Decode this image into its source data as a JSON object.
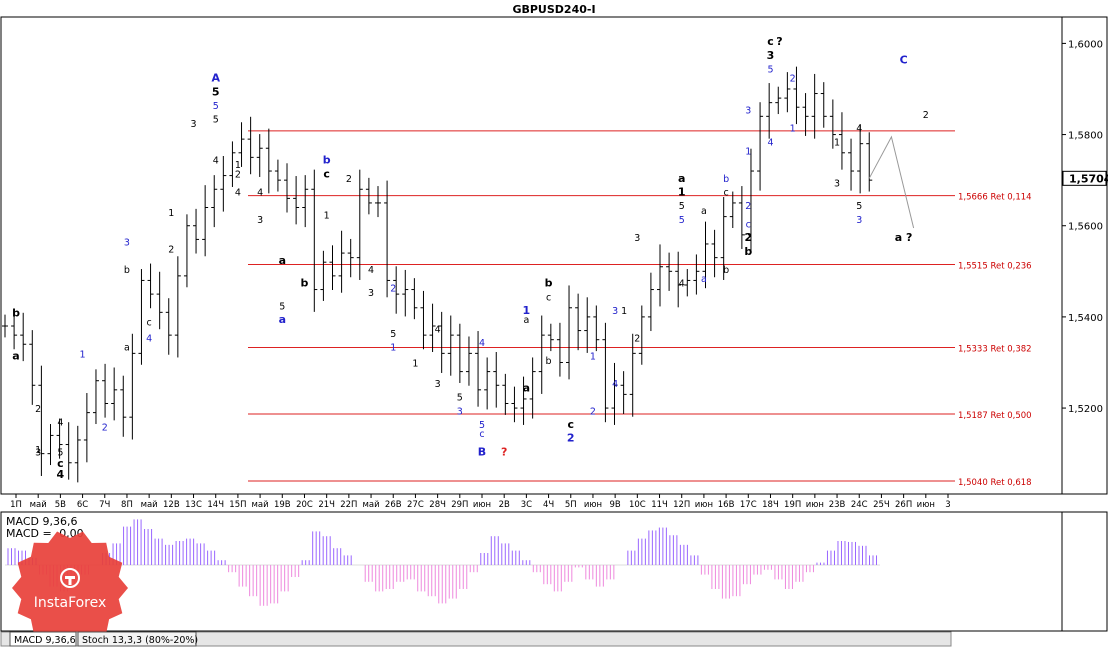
{
  "chart_data": {
    "type": "ohlc",
    "title": "GBPUSD240-I",
    "xlabel": "",
    "ylabel": "",
    "ylim": [
      1.504,
      1.6025
    ],
    "y_ticks": [
      "1,6000",
      "1,5800",
      "1,5600",
      "1,5400",
      "1,5200"
    ],
    "y_tick_values": [
      1.6,
      1.58,
      1.56,
      1.54,
      1.52
    ],
    "current_price": "1,5704",
    "current_price_value": 1.5704,
    "x_tick_labels": [
      "1П",
      "май",
      "5В",
      "6С",
      "7Ч",
      "8П",
      "май",
      "12В",
      "13С",
      "14Ч",
      "15П",
      "май",
      "19В",
      "20С",
      "21Ч",
      "22П",
      "май",
      "26В",
      "27С",
      "28Ч",
      "29П",
      "июн",
      "2В",
      "3С",
      "4Ч",
      "5П",
      "июн",
      "9В",
      "10С",
      "11Ч",
      "12П",
      "июн",
      "16В",
      "17С",
      "18Ч",
      "19П",
      "июн",
      "23В",
      "24С",
      "25Ч",
      "26П",
      "июн",
      "3"
    ],
    "close_series": [
      1.538,
      1.536,
      1.534,
      1.525,
      1.51,
      1.514,
      1.512,
      1.508,
      1.513,
      1.519,
      1.526,
      1.521,
      1.524,
      1.518,
      1.532,
      1.548,
      1.545,
      1.541,
      1.536,
      1.549,
      1.56,
      1.557,
      1.564,
      1.568,
      1.571,
      1.576,
      1.579,
      1.575,
      1.577,
      1.572,
      1.57,
      1.566,
      1.564,
      1.568,
      1.546,
      1.552,
      1.549,
      1.554,
      1.553,
      1.568,
      1.565,
      1.565,
      1.548,
      1.545,
      1.546,
      1.542,
      1.536,
      1.538,
      1.532,
      1.536,
      1.528,
      1.532,
      1.524,
      1.528,
      1.525,
      1.521,
      1.52,
      1.522,
      1.528,
      1.536,
      1.535,
      1.53,
      1.542,
      1.537,
      1.54,
      1.535,
      1.52,
      1.525,
      1.523,
      1.532,
      1.54,
      1.546,
      1.551,
      1.55,
      1.547,
      1.548,
      1.55,
      1.556,
      1.553,
      1.562,
      1.565,
      1.558,
      1.572,
      1.584,
      1.587,
      1.588,
      1.59,
      1.586,
      1.584,
      1.589,
      1.584,
      1.58,
      1.576,
      1.572,
      1.578,
      1.57
    ],
    "price_lines": [
      {
        "label": "1,5666 Ret 0,114",
        "value": 1.5666
      },
      {
        "label": "1,5515 Ret 0,236",
        "value": 1.5515
      },
      {
        "label": "1,5333 Ret 0,382",
        "value": 1.5333
      },
      {
        "label": "1,5187 Ret 0,500",
        "value": 1.5187
      },
      {
        "label": "1,5040 Ret 0,618",
        "value": 1.504
      }
    ],
    "top_line_value": 1.5808,
    "projection": [
      {
        "x": "24С",
        "y": 1.5704
      },
      {
        "x": "25Ч",
        "y": 1.5795
      },
      {
        "x": "26П",
        "y": 1.5595
      }
    ],
    "wave_labels": [
      {
        "text": "b",
        "x": "1П",
        "y": 1.541,
        "color": "#000000",
        "bold": true
      },
      {
        "text": "a",
        "x": "1П",
        "y": 1.5315,
        "color": "#000000",
        "bold": true
      },
      {
        "text": "1",
        "x": "май",
        "y": 1.511,
        "color": "#000000",
        "bold": false
      },
      {
        "text": "2",
        "x": "май",
        "y": 1.52,
        "color": "#000000",
        "bold": false
      },
      {
        "text": "3",
        "x": "май",
        "y": 1.5105,
        "color": "#000000",
        "bold": false
      },
      {
        "text": "4",
        "x": "5В",
        "y": 1.517,
        "color": "#000000",
        "bold": false
      },
      {
        "text": "5",
        "x": "5В",
        "y": 1.5105,
        "color": "#000000",
        "bold": false
      },
      {
        "text": "c",
        "x": "5В",
        "y": 1.508,
        "color": "#000000",
        "bold": true
      },
      {
        "text": "4",
        "x": "5В",
        "y": 1.5055,
        "color": "#000000",
        "bold": true
      },
      {
        "text": "1",
        "x": "6С",
        "y": 1.532,
        "color": "#2222cc",
        "bold": false
      },
      {
        "text": "2",
        "x": "7Ч",
        "y": 1.516,
        "color": "#2222cc",
        "bold": false
      },
      {
        "text": "3",
        "x": "8П",
        "y": 1.5565,
        "color": "#2222cc",
        "bold": false
      },
      {
        "text": "a",
        "x": "8П",
        "y": 1.5335,
        "color": "#000000",
        "bold": false
      },
      {
        "text": "b",
        "x": "8П",
        "y": 1.5505,
        "color": "#000000",
        "bold": false
      },
      {
        "text": "c",
        "x": "май",
        "y": 1.539,
        "color": "#000000",
        "bold": false
      },
      {
        "text": "4",
        "x": "май",
        "y": 1.5355,
        "color": "#2222cc",
        "bold": false
      },
      {
        "text": "1",
        "x": "12В",
        "y": 1.563,
        "color": "#000000",
        "bold": false
      },
      {
        "text": "2",
        "x": "12В",
        "y": 1.555,
        "color": "#000000",
        "bold": false
      },
      {
        "text": "3",
        "x": "13С",
        "y": 1.5825,
        "color": "#000000",
        "bold": false
      },
      {
        "text": "4",
        "x": "14Ч",
        "y": 1.5745,
        "color": "#000000",
        "bold": false
      },
      {
        "text": "A",
        "x": "14Ч",
        "y": 1.5925,
        "color": "#2222cc",
        "bold": true
      },
      {
        "text": "5",
        "x": "14Ч",
        "y": 1.5895,
        "color": "#000000",
        "bold": true
      },
      {
        "text": "5",
        "x": "14Ч",
        "y": 1.5865,
        "color": "#2222cc",
        "bold": false
      },
      {
        "text": "5",
        "x": "14Ч",
        "y": 1.5835,
        "color": "#000000",
        "bold": false
      },
      {
        "text": "4",
        "x": "15П",
        "y": 1.5675,
        "color": "#000000",
        "bold": false
      },
      {
        "text": "1",
        "x": "15П",
        "y": 1.5735,
        "color": "#000000",
        "bold": false
      },
      {
        "text": "2",
        "x": "15П",
        "y": 1.5715,
        "color": "#000000",
        "bold": false
      },
      {
        "text": "3",
        "x": "май",
        "y": 1.5615,
        "color": "#000000",
        "bold": false
      },
      {
        "text": "4",
        "x": "май",
        "y": 1.5675,
        "color": "#000000",
        "bold": false
      },
      {
        "text": "a",
        "x": "19В",
        "y": 1.5525,
        "color": "#000000",
        "bold": true
      },
      {
        "text": "5",
        "x": "19В",
        "y": 1.5425,
        "color": "#000000",
        "bold": false
      },
      {
        "text": "a",
        "x": "19В",
        "y": 1.5395,
        "color": "#2222cc",
        "bold": true
      },
      {
        "text": "b",
        "x": "20С",
        "y": 1.5475,
        "color": "#000000",
        "bold": true
      },
      {
        "text": "b",
        "x": "21Ч",
        "y": 1.5745,
        "color": "#2222cc",
        "bold": true
      },
      {
        "text": "c",
        "x": "21Ч",
        "y": 1.5715,
        "color": "#000000",
        "bold": true
      },
      {
        "text": "1",
        "x": "21Ч",
        "y": 1.5625,
        "color": "#000000",
        "bold": false
      },
      {
        "text": "2",
        "x": "22П",
        "y": 1.5705,
        "color": "#000000",
        "bold": false
      },
      {
        "text": "3",
        "x": "май",
        "y": 1.5455,
        "color": "#000000",
        "bold": false
      },
      {
        "text": "4",
        "x": "май",
        "y": 1.5505,
        "color": "#000000",
        "bold": false
      },
      {
        "text": "2",
        "x": "26В",
        "y": 1.5465,
        "color": "#2222cc",
        "bold": false
      },
      {
        "text": "5",
        "x": "26В",
        "y": 1.5365,
        "color": "#000000",
        "bold": false
      },
      {
        "text": "1",
        "x": "26В",
        "y": 1.5335,
        "color": "#2222cc",
        "bold": false
      },
      {
        "text": "1",
        "x": "27С",
        "y": 1.53,
        "color": "#000000",
        "bold": false
      },
      {
        "text": "4",
        "x": "28Ч",
        "y": 1.5375,
        "color": "#000000",
        "bold": false
      },
      {
        "text": "3",
        "x": "28Ч",
        "y": 1.5255,
        "color": "#000000",
        "bold": false
      },
      {
        "text": "5",
        "x": "29П",
        "y": 1.5225,
        "color": "#000000",
        "bold": false
      },
      {
        "text": "3",
        "x": "29П",
        "y": 1.5195,
        "color": "#2222cc",
        "bold": false
      },
      {
        "text": "4",
        "x": "июн",
        "y": 1.5345,
        "color": "#2222cc",
        "bold": false
      },
      {
        "text": "5",
        "x": "июн",
        "y": 1.5165,
        "color": "#2222cc",
        "bold": false
      },
      {
        "text": "c",
        "x": "июн",
        "y": 1.5145,
        "color": "#2222cc",
        "bold": false
      },
      {
        "text": "B",
        "x": "июн",
        "y": 1.5105,
        "color": "#2222cc",
        "bold": true
      },
      {
        "text": "?",
        "x": "2В",
        "y": 1.5105,
        "color": "#dd2222",
        "bold": true
      },
      {
        "text": "1",
        "x": "3С",
        "y": 1.5415,
        "color": "#2222cc",
        "bold": true
      },
      {
        "text": "a",
        "x": "3С",
        "y": 1.5395,
        "color": "#000000",
        "bold": false
      },
      {
        "text": "a",
        "x": "3С",
        "y": 1.5245,
        "color": "#000000",
        "bold": true
      },
      {
        "text": "b",
        "x": "4Ч",
        "y": 1.5475,
        "color": "#000000",
        "bold": true
      },
      {
        "text": "c",
        "x": "4Ч",
        "y": 1.5445,
        "color": "#000000",
        "bold": false
      },
      {
        "text": "b",
        "x": "4Ч",
        "y": 1.5305,
        "color": "#000000",
        "bold": false
      },
      {
        "text": "c",
        "x": "5П",
        "y": 1.5165,
        "color": "#000000",
        "bold": true
      },
      {
        "text": "2",
        "x": "5П",
        "y": 1.5135,
        "color": "#2222cc",
        "bold": true
      },
      {
        "text": "1",
        "x": "июн",
        "y": 1.5315,
        "color": "#2222cc",
        "bold": false
      },
      {
        "text": "2",
        "x": "июн",
        "y": 1.5195,
        "color": "#2222cc",
        "bold": false
      },
      {
        "text": "3",
        "x": "9В",
        "y": 1.5415,
        "color": "#2222cc",
        "bold": false
      },
      {
        "text": "4",
        "x": "9В",
        "y": 1.5255,
        "color": "#2222cc",
        "bold": false
      },
      {
        "text": "1",
        "x": "9В",
        "y": 1.5415,
        "color": "#000000",
        "bold": false
      },
      {
        "text": "2",
        "x": "10С",
        "y": 1.5355,
        "color": "#000000",
        "bold": false
      },
      {
        "text": "3",
        "x": "10С",
        "y": 1.5575,
        "color": "#000000",
        "bold": false
      },
      {
        "text": "4",
        "x": "12П",
        "y": 1.5475,
        "color": "#000000",
        "bold": false
      },
      {
        "text": "a",
        "x": "12П",
        "y": 1.5705,
        "color": "#000000",
        "bold": true
      },
      {
        "text": "1",
        "x": "12П",
        "y": 1.5675,
        "color": "#000000",
        "bold": true
      },
      {
        "text": "5",
        "x": "12П",
        "y": 1.5645,
        "color": "#000000",
        "bold": false
      },
      {
        "text": "5",
        "x": "12П",
        "y": 1.5615,
        "color": "#2222cc",
        "bold": false
      },
      {
        "text": "a",
        "x": "июн",
        "y": 1.5635,
        "color": "#000000",
        "bold": false
      },
      {
        "text": "a",
        "x": "июн",
        "y": 1.5485,
        "color": "#2222cc",
        "bold": false
      },
      {
        "text": "b",
        "x": "16В",
        "y": 1.5505,
        "color": "#000000",
        "bold": false
      },
      {
        "text": "b",
        "x": "16В",
        "y": 1.5705,
        "color": "#2222cc",
        "bold": false
      },
      {
        "text": "c",
        "x": "16В",
        "y": 1.5675,
        "color": "#000000",
        "bold": false
      },
      {
        "text": "c",
        "x": "17С",
        "y": 1.5605,
        "color": "#2222cc",
        "bold": false
      },
      {
        "text": "2",
        "x": "17С",
        "y": 1.5575,
        "color": "#000000",
        "bold": true
      },
      {
        "text": "b",
        "x": "17С",
        "y": 1.5545,
        "color": "#000000",
        "bold": true
      },
      {
        "text": "2",
        "x": "17С",
        "y": 1.5645,
        "color": "#2222cc",
        "bold": false
      },
      {
        "text": "1",
        "x": "17С",
        "y": 1.5765,
        "color": "#2222cc",
        "bold": false
      },
      {
        "text": "3",
        "x": "17С",
        "y": 1.5855,
        "color": "#2222cc",
        "bold": false
      },
      {
        "text": "4",
        "x": "18Ч",
        "y": 1.5785,
        "color": "#2222cc",
        "bold": false
      },
      {
        "text": "c",
        "x": "18Ч",
        "y": 1.6005,
        "color": "#000000",
        "bold": true
      },
      {
        "text": "?",
        "x": "18Ч",
        "y": 1.6005,
        "color": "#000000",
        "bold": true
      },
      {
        "text": "3",
        "x": "18Ч",
        "y": 1.5975,
        "color": "#000000",
        "bold": true
      },
      {
        "text": "5",
        "x": "18Ч",
        "y": 1.5945,
        "color": "#2222cc",
        "bold": false
      },
      {
        "text": "1",
        "x": "19П",
        "y": 1.5815,
        "color": "#2222cc",
        "bold": false
      },
      {
        "text": "2",
        "x": "19П",
        "y": 1.5925,
        "color": "#2222cc",
        "bold": false
      },
      {
        "text": "2",
        "x": "июн",
        "y": 1.5845,
        "color": "#000000",
        "bold": false
      },
      {
        "text": "1",
        "x": "23В",
        "y": 1.5785,
        "color": "#000000",
        "bold": false
      },
      {
        "text": "3",
        "x": "23В",
        "y": 1.5695,
        "color": "#000000",
        "bold": false
      },
      {
        "text": "4",
        "x": "24С",
        "y": 1.5815,
        "color": "#000000",
        "bold": false
      },
      {
        "text": "5",
        "x": "24С",
        "y": 1.5645,
        "color": "#000000",
        "bold": false
      },
      {
        "text": "3",
        "x": "24С",
        "y": 1.5615,
        "color": "#2222cc",
        "bold": false
      },
      {
        "text": "C",
        "x": "26П",
        "y": 1.5965,
        "color": "#2222cc",
        "bold": true
      },
      {
        "text": "a ?",
        "x": "26П",
        "y": 1.5575,
        "color": "#000000",
        "bold": true
      }
    ],
    "macd": {
      "label": "MACD 9,36,6",
      "label2_prefix": "MACD =",
      "label2_value": "0,00",
      "values": [
        0.35,
        0.3,
        0.15,
        -0.2,
        -0.45,
        -0.55,
        -0.4,
        -0.2,
        0.0,
        0.25,
        0.45,
        0.8,
        0.95,
        0.75,
        0.55,
        0.42,
        0.5,
        0.55,
        0.45,
        0.3,
        0.1,
        -0.15,
        -0.45,
        -0.65,
        -0.85,
        -0.8,
        -0.55,
        -0.25,
        0.1,
        0.7,
        0.6,
        0.35,
        0.2,
        0.0,
        -0.35,
        -0.55,
        -0.5,
        -0.35,
        -0.3,
        -0.55,
        -0.65,
        -0.8,
        -0.7,
        -0.5,
        -0.15,
        0.25,
        0.6,
        0.45,
        0.3,
        0.1,
        -0.15,
        -0.4,
        -0.55,
        -0.35,
        -0.05,
        -0.3,
        -0.45,
        -0.3,
        0.0,
        0.3,
        0.55,
        0.72,
        0.78,
        0.62,
        0.42,
        0.2,
        -0.2,
        -0.5,
        -0.7,
        -0.65,
        -0.4,
        -0.2,
        -0.1,
        -0.3,
        -0.5,
        -0.35,
        -0.15,
        0.05,
        0.3,
        0.5,
        0.48,
        0.4,
        0.2,
        0.0
      ],
      "pos_color": "#9966ff",
      "neg_color": "#ee88dd"
    },
    "tabs": [
      "MACD 9,36,6",
      "Stoch 13,3,3 (80%-20%)"
    ],
    "price_line_color": "#dd2222",
    "line_label_color": "#cc0000",
    "watermark_text": "InstaForex",
    "watermark_color": "#e8403a",
    "grid": false
  }
}
